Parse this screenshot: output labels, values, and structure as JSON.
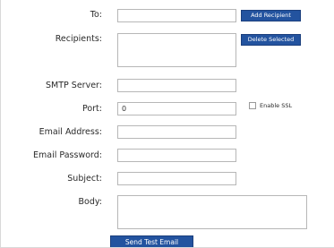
{
  "form": {
    "to": {
      "label": "To:",
      "value": ""
    },
    "recipients": {
      "label": "Recipients:",
      "value": ""
    },
    "smtp_server": {
      "label": "SMTP Server:",
      "value": ""
    },
    "port": {
      "label": "Port:",
      "value": "0"
    },
    "email_address": {
      "label": "Email Address:",
      "value": ""
    },
    "email_password": {
      "label": "Email Password:",
      "value": ""
    },
    "subject": {
      "label": "Subject:",
      "value": ""
    },
    "body": {
      "label": "Body:",
      "value": ""
    },
    "enable_ssl": {
      "label": "Enable SSL",
      "checked": false
    }
  },
  "buttons": {
    "add_recipient": "Add Recipient",
    "delete_selected": "Delete Selected",
    "send_test_email": "Send Test Email"
  },
  "colors": {
    "button_bg": "#23539f",
    "button_text": "#ffffff",
    "field_border": "#b7b7b7"
  }
}
